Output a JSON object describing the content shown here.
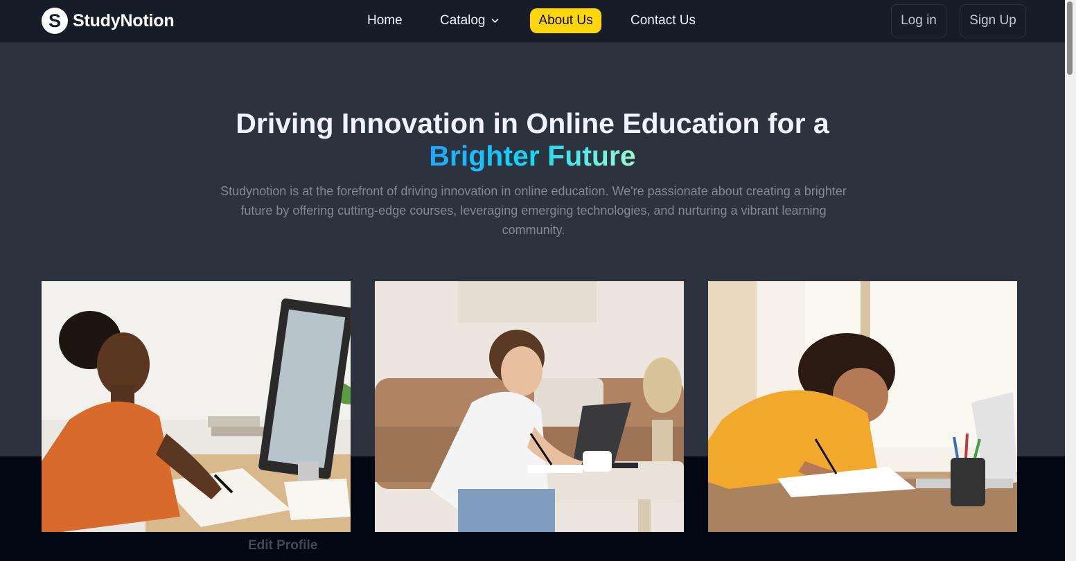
{
  "navbar": {
    "logo_letter": "S",
    "brand_name": "StudyNotion",
    "links": {
      "home": "Home",
      "catalog": "Catalog",
      "about": "About Us",
      "contact": "Contact Us"
    },
    "login_label": "Log in",
    "signup_label": "Sign Up",
    "active_link": "About Us"
  },
  "hero": {
    "title_line1": "Driving Innovation in Online Education for a",
    "title_highlight": "Brighter Future",
    "description": "Studynotion is at the forefront of driving innovation in online education. We're passionate about creating a brighter future by offering cutting-edge courses, leveraging emerging technologies, and nurturing a vibrant learning community."
  },
  "images": [
    {
      "subject": "woman-at-desktop-computer-writing"
    },
    {
      "subject": "woman-on-floor-with-laptop-writing"
    },
    {
      "subject": "girl-in-yellow-shirt-writing-at-table"
    }
  ],
  "partial_text": {
    "edit_profile": "Edit Profile"
  },
  "colors": {
    "page_bg": "#2c333f",
    "navbar_bg": "#161d29",
    "accent_yellow": "#ffd60a",
    "dark_band": "#000814",
    "gradient": [
      "#1fa2ff",
      "#12d8fa",
      "#a6ffcb"
    ],
    "body_text_muted": "#838894"
  },
  "icons": {
    "catalog_dropdown": "chevron-down-icon"
  }
}
